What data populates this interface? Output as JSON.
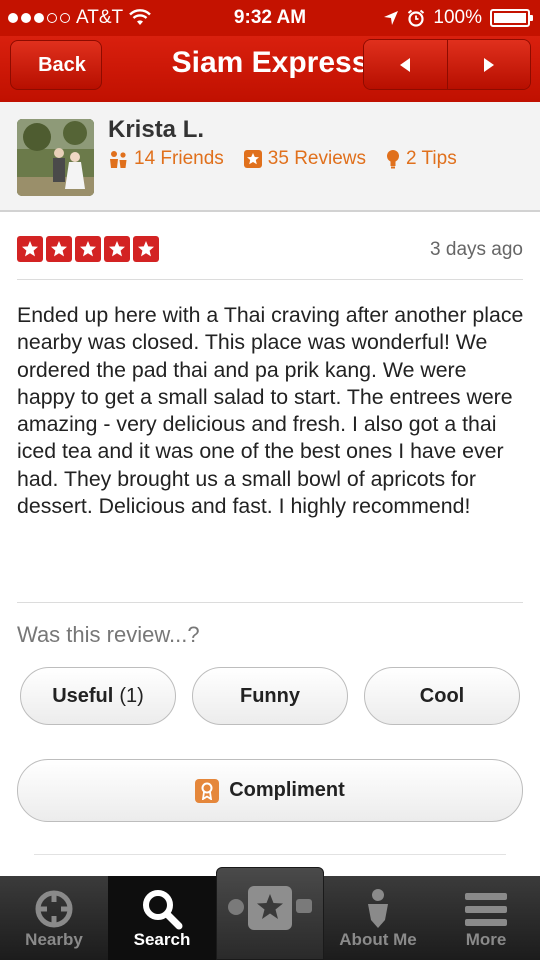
{
  "status_bar": {
    "carrier": "AT&T",
    "time": "9:32 AM",
    "battery": "100%",
    "icons": [
      "signal-dots-icon",
      "wifi-icon",
      "location-arrow-icon",
      "alarm-icon",
      "battery-icon"
    ]
  },
  "nav": {
    "back_label": "Back",
    "title": "Siam Express",
    "prev_icon": "triangle-left-icon",
    "next_icon": "triangle-right-icon"
  },
  "reviewer": {
    "name": "Krista L.",
    "friends": "14 Friends",
    "reviews": "35 Reviews",
    "tips": "2 Tips"
  },
  "review": {
    "rating": 5,
    "max_rating": 5,
    "date": "3 days ago",
    "text": "Ended up here with a Thai craving after another place nearby was closed.  This place was wonderful!  We ordered the pad thai and pa prik kang.  We were happy to get a small salad to start.  The entrees were amazing - very delicious and fresh.  I also got a thai iced tea and it was one of the best ones I have ever had.  They brought us a small bowl of apricots for dessert.  Delicious and fast. I highly recommend!"
  },
  "feedback": {
    "prompt": "Was this review...?",
    "useful_label": "Useful",
    "useful_count": "(1)",
    "funny_label": "Funny",
    "cool_label": "Cool",
    "compliment_label": "Compliment"
  },
  "tabbar": {
    "tabs": [
      {
        "label": "Nearby",
        "icon": "crosshair-icon",
        "active": false
      },
      {
        "label": "Search",
        "icon": "search-icon",
        "active": true
      },
      {
        "label": "",
        "icon": "star-camera-icon",
        "active": false
      },
      {
        "label": "About Me",
        "icon": "person-icon",
        "active": false
      },
      {
        "label": "More",
        "icon": "menu-icon",
        "active": false
      }
    ]
  },
  "colors": {
    "brand_red": "#c41200",
    "star_red": "#d32323",
    "stat_orange": "#e0701c"
  }
}
